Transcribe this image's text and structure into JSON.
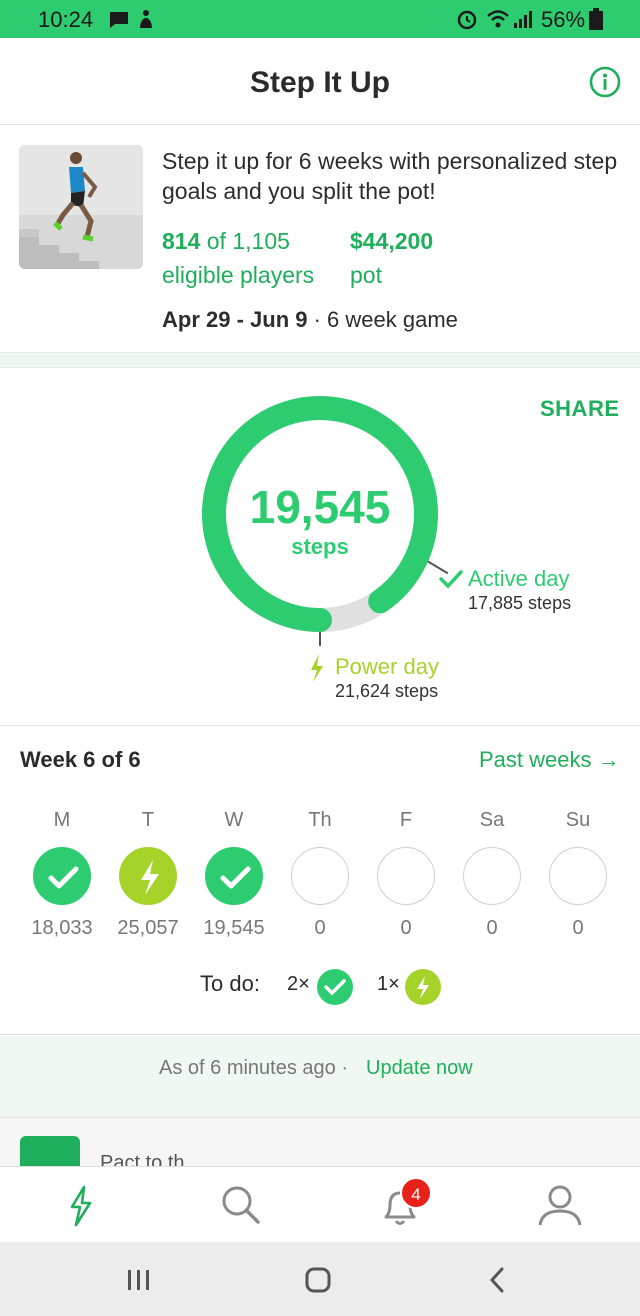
{
  "status_bar": {
    "time": "10:24",
    "battery": "56%",
    "bg_color": "#2ecc71",
    "icons": [
      "message-icon",
      "notification-icon",
      "alarm-icon",
      "wifi-icon",
      "signal-icon",
      "battery-icon"
    ]
  },
  "header": {
    "title": "Step It Up",
    "info_icon": "info-icon"
  },
  "game": {
    "description": "Step it up for 6 weeks with personalized step goals and you split the pot!",
    "players_count": "814",
    "players_of": "of",
    "players_total": "1,105",
    "players_label": "eligible players",
    "pot_amount": "$44,200",
    "pot_label": "pot",
    "date_range": "Apr 29 - Jun 9",
    "game_length": "· 6 week game"
  },
  "steps": {
    "share_label": "SHARE",
    "current": "19,545",
    "unit": "steps",
    "current_value": 19545,
    "active_day_label": "Active day",
    "active_day_steps": "17,885 steps",
    "active_day_value": 17885,
    "power_day_label": "Power day",
    "power_day_steps": "21,624 steps",
    "power_day_value": 21624,
    "colors": {
      "active": "#2ecc71",
      "power": "#a6d32a",
      "track": "#e0e0e0"
    }
  },
  "week": {
    "title": "Week 6 of 6",
    "past_weeks_label": "Past weeks →",
    "days": [
      {
        "label": "M",
        "value": "18,033",
        "status": "active"
      },
      {
        "label": "T",
        "value": "25,057",
        "status": "power"
      },
      {
        "label": "W",
        "value": "19,545",
        "status": "active"
      },
      {
        "label": "Th",
        "value": "0",
        "status": "empty"
      },
      {
        "label": "F",
        "value": "0",
        "status": "empty"
      },
      {
        "label": "Sa",
        "value": "0",
        "status": "empty"
      },
      {
        "label": "Su",
        "value": "0",
        "status": "empty"
      }
    ],
    "todo_label": "To do:",
    "todo_active": "2×",
    "todo_power": "1×"
  },
  "update": {
    "ago": "As of 6 minutes ago ·",
    "update_now": "Update now"
  },
  "peek_card": {
    "text": "Pact to th"
  },
  "tabbar": {
    "tabs": [
      "games-tab",
      "search-tab",
      "notifications-tab",
      "profile-tab"
    ],
    "notification_count": "4"
  }
}
